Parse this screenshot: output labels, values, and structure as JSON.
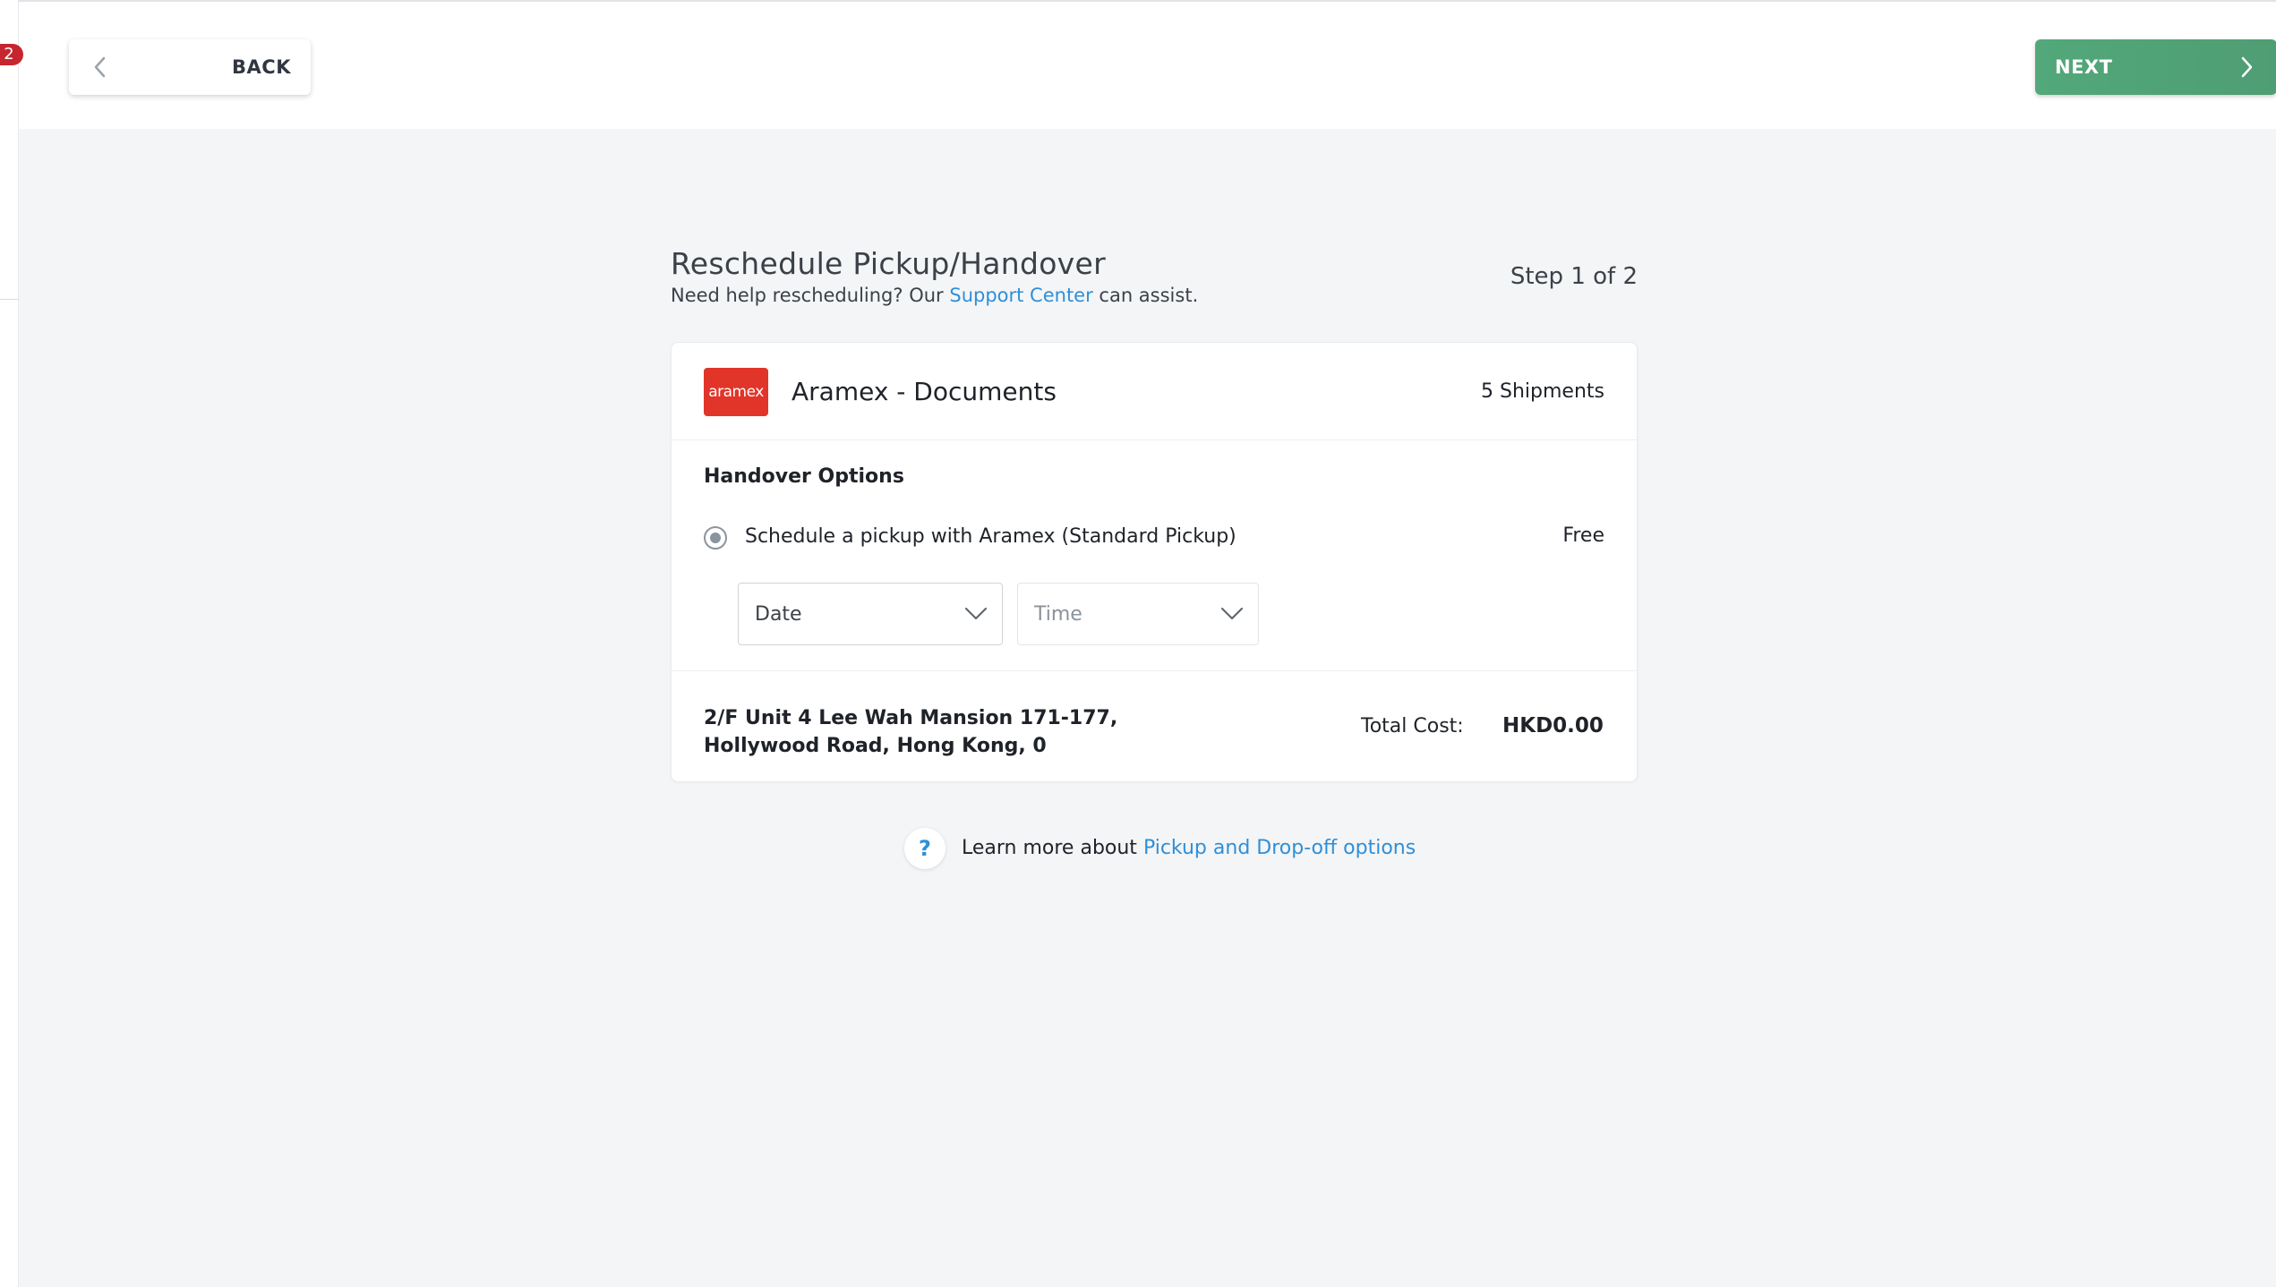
{
  "nav": {
    "notification_count": "2",
    "back_label": "BACK",
    "next_label": "NEXT"
  },
  "header": {
    "title": "Reschedule Pickup/Handover",
    "subtitle_prefix": "Need help rescheduling? Our ",
    "subtitle_link": "Support Center",
    "subtitle_suffix": " can assist.",
    "step": "Step 1 of 2"
  },
  "card": {
    "logo_text": "aramex",
    "carrier_name": "Aramex - Documents",
    "shipments": "5 Shipments",
    "handover_title": "Handover Options",
    "option_label": "Schedule a pickup with Aramex (Standard Pickup)",
    "option_price": "Free",
    "date_value": "Date",
    "time_placeholder": "Time",
    "address": "2/F Unit 4 Lee Wah Mansion 171-177, Hollywood Road, Hong Kong, 0",
    "total_label": "Total Cost:",
    "total_value": "HKD0.00"
  },
  "help": {
    "icon": "?",
    "text_prefix": "Learn more about ",
    "link": "Pickup and Drop-off options"
  },
  "colors": {
    "accent_green": "#52a87a",
    "link_blue": "#2f8fd8",
    "aramex_red": "#e1352a",
    "badge_red": "#c6262e"
  }
}
